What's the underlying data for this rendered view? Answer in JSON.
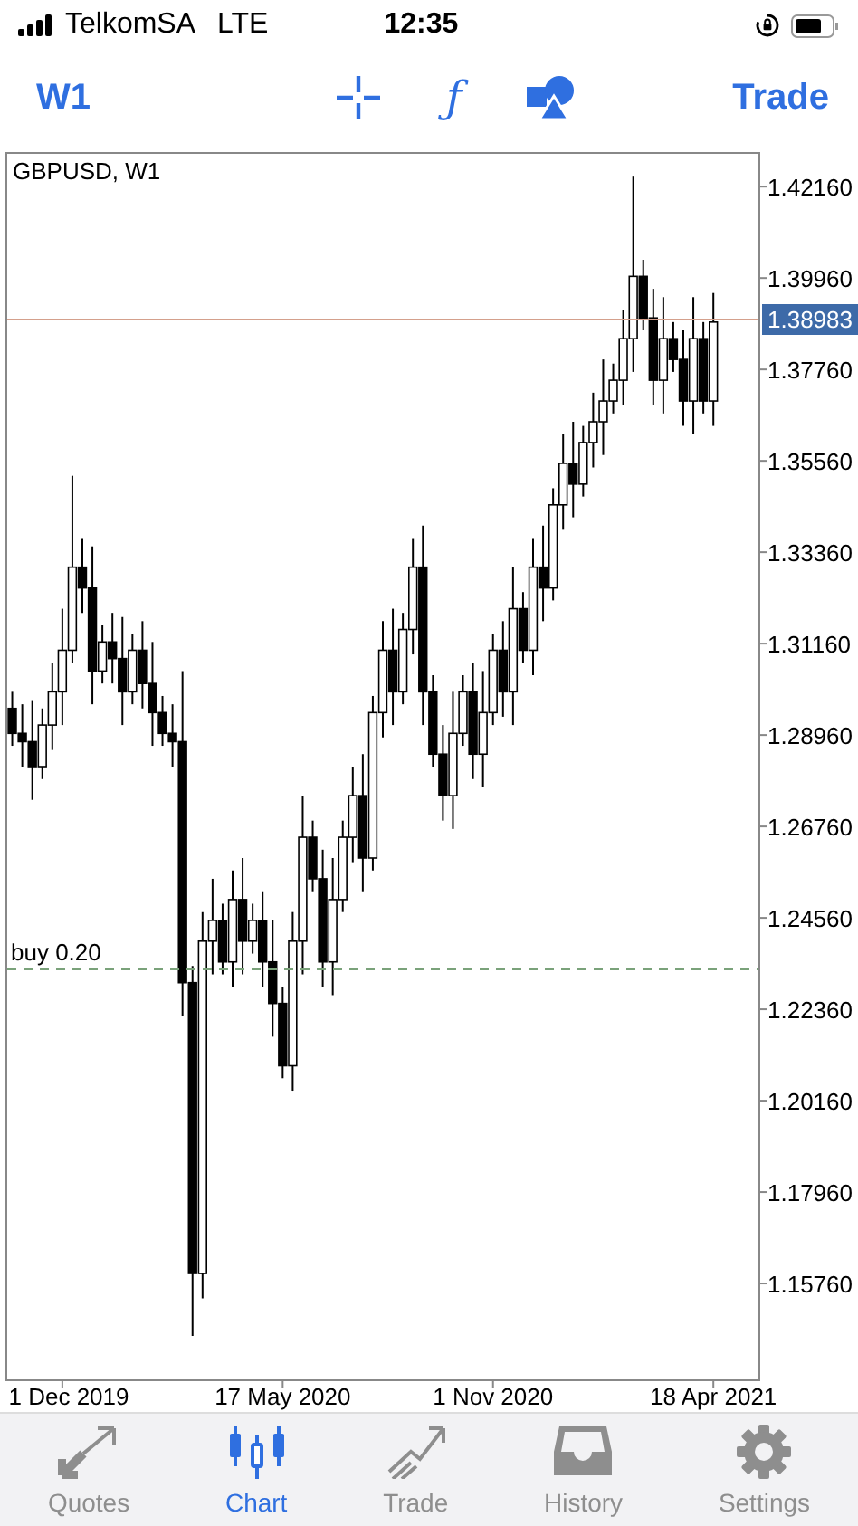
{
  "status_bar": {
    "carrier": "TelkomSA",
    "network": "LTE",
    "time": "12:35"
  },
  "toolbar": {
    "timeframe": "W1",
    "function_glyph": "ƒ",
    "trade": "Trade"
  },
  "chart": {
    "chart_data": {
      "type": "candlestick",
      "title": "GBPUSD, W1",
      "categories": [
        null,
        null,
        null,
        null,
        null,
        "1 Dec 2019",
        null,
        null,
        null,
        null,
        null,
        null,
        null,
        null,
        null,
        null,
        null,
        null,
        null,
        null,
        null,
        null,
        null,
        null,
        null,
        null,
        null,
        "17 May 2020",
        null,
        null,
        null,
        null,
        null,
        null,
        null,
        null,
        null,
        null,
        null,
        null,
        null,
        null,
        null,
        null,
        null,
        null,
        null,
        null,
        "1 Nov 2020",
        null,
        null,
        null,
        null,
        null,
        null,
        null,
        null,
        null,
        null,
        null,
        null,
        null,
        null,
        null,
        null,
        null,
        null,
        null,
        null,
        null,
        "18 Apr 2021",
        null,
        null,
        null,
        null
      ],
      "ohlc": [
        [
          1.296,
          1.3,
          1.287,
          1.29
        ],
        [
          1.29,
          1.297,
          1.282,
          1.288
        ],
        [
          1.288,
          1.298,
          1.274,
          1.282
        ],
        [
          1.282,
          1.296,
          1.279,
          1.292
        ],
        [
          1.292,
          1.307,
          1.286,
          1.3
        ],
        [
          1.3,
          1.32,
          1.292,
          1.31
        ],
        [
          1.31,
          1.352,
          1.307,
          1.33
        ],
        [
          1.33,
          1.337,
          1.319,
          1.325
        ],
        [
          1.325,
          1.335,
          1.297,
          1.305
        ],
        [
          1.305,
          1.316,
          1.302,
          1.312
        ],
        [
          1.312,
          1.319,
          1.302,
          1.308
        ],
        [
          1.308,
          1.318,
          1.292,
          1.3
        ],
        [
          1.3,
          1.314,
          1.297,
          1.31
        ],
        [
          1.31,
          1.317,
          1.296,
          1.302
        ],
        [
          1.302,
          1.312,
          1.287,
          1.295
        ],
        [
          1.295,
          1.299,
          1.287,
          1.29
        ],
        [
          1.29,
          1.297,
          1.282,
          1.288
        ],
        [
          1.288,
          1.305,
          1.222,
          1.23
        ],
        [
          1.23,
          1.234,
          1.145,
          1.16
        ],
        [
          1.16,
          1.247,
          1.154,
          1.24
        ],
        [
          1.24,
          1.255,
          1.232,
          1.245
        ],
        [
          1.245,
          1.249,
          1.232,
          1.235
        ],
        [
          1.235,
          1.257,
          1.229,
          1.25
        ],
        [
          1.25,
          1.26,
          1.232,
          1.24
        ],
        [
          1.24,
          1.249,
          1.237,
          1.245
        ],
        [
          1.245,
          1.252,
          1.229,
          1.235
        ],
        [
          1.235,
          1.245,
          1.217,
          1.225
        ],
        [
          1.225,
          1.229,
          1.207,
          1.21
        ],
        [
          1.21,
          1.247,
          1.204,
          1.24
        ],
        [
          1.24,
          1.275,
          1.232,
          1.265
        ],
        [
          1.265,
          1.269,
          1.252,
          1.255
        ],
        [
          1.255,
          1.262,
          1.229,
          1.235
        ],
        [
          1.235,
          1.26,
          1.227,
          1.25
        ],
        [
          1.25,
          1.269,
          1.247,
          1.265
        ],
        [
          1.265,
          1.282,
          1.259,
          1.275
        ],
        [
          1.275,
          1.285,
          1.252,
          1.26
        ],
        [
          1.26,
          1.299,
          1.257,
          1.295
        ],
        [
          1.295,
          1.317,
          1.289,
          1.31
        ],
        [
          1.31,
          1.32,
          1.292,
          1.3
        ],
        [
          1.3,
          1.319,
          1.297,
          1.315
        ],
        [
          1.315,
          1.337,
          1.309,
          1.33
        ],
        [
          1.33,
          1.34,
          1.292,
          1.3
        ],
        [
          1.3,
          1.304,
          1.282,
          1.285
        ],
        [
          1.285,
          1.292,
          1.269,
          1.275
        ],
        [
          1.275,
          1.3,
          1.267,
          1.29
        ],
        [
          1.29,
          1.304,
          1.287,
          1.3
        ],
        [
          1.3,
          1.307,
          1.279,
          1.285
        ],
        [
          1.285,
          1.305,
          1.277,
          1.295
        ],
        [
          1.295,
          1.314,
          1.292,
          1.31
        ],
        [
          1.31,
          1.317,
          1.294,
          1.3
        ],
        [
          1.3,
          1.33,
          1.292,
          1.32
        ],
        [
          1.32,
          1.324,
          1.307,
          1.31
        ],
        [
          1.31,
          1.337,
          1.304,
          1.33
        ],
        [
          1.33,
          1.34,
          1.317,
          1.325
        ],
        [
          1.325,
          1.349,
          1.322,
          1.345
        ],
        [
          1.345,
          1.362,
          1.339,
          1.355
        ],
        [
          1.355,
          1.365,
          1.342,
          1.35
        ],
        [
          1.35,
          1.364,
          1.347,
          1.36
        ],
        [
          1.36,
          1.372,
          1.354,
          1.365
        ],
        [
          1.365,
          1.38,
          1.357,
          1.37
        ],
        [
          1.37,
          1.379,
          1.367,
          1.375
        ],
        [
          1.375,
          1.392,
          1.369,
          1.385
        ],
        [
          1.385,
          1.424,
          1.377,
          1.4
        ],
        [
          1.4,
          1.404,
          1.387,
          1.39
        ],
        [
          1.39,
          1.397,
          1.369,
          1.375
        ],
        [
          1.375,
          1.395,
          1.367,
          1.385
        ],
        [
          1.385,
          1.389,
          1.377,
          1.38
        ],
        [
          1.38,
          1.387,
          1.364,
          1.37
        ],
        [
          1.37,
          1.395,
          1.362,
          1.385
        ],
        [
          1.385,
          1.389,
          1.367,
          1.37
        ],
        [
          1.37,
          1.396,
          1.364,
          1.389
        ],
        null,
        null,
        null,
        null
      ],
      "ylim": [
        1.1343,
        1.4297
      ],
      "yticks": [
        {
          "value": 1.4216,
          "label": "1.42160"
        },
        {
          "value": 1.3996,
          "label": "1.39960"
        },
        {
          "value": 1.3776,
          "label": "1.37760"
        },
        {
          "value": 1.3556,
          "label": "1.35560"
        },
        {
          "value": 1.3336,
          "label": "1.33360"
        },
        {
          "value": 1.3116,
          "label": "1.31160"
        },
        {
          "value": 1.2896,
          "label": "1.28960"
        },
        {
          "value": 1.2676,
          "label": "1.26760"
        },
        {
          "value": 1.2456,
          "label": "1.24560"
        },
        {
          "value": 1.2236,
          "label": "1.22360"
        },
        {
          "value": 1.2016,
          "label": "1.20160"
        },
        {
          "value": 1.1796,
          "label": "1.17960"
        },
        {
          "value": 1.1576,
          "label": "1.15760"
        }
      ],
      "ref_lines": [
        {
          "axis": "y",
          "value": 1.38983,
          "label": "1.38983"
        },
        {
          "axis": "y",
          "value": 1.2335,
          "label": "buy 0.20"
        }
      ]
    }
  },
  "tabs": [
    {
      "label": "Quotes",
      "selected": false
    },
    {
      "label": "Chart",
      "selected": true
    },
    {
      "label": "Trade",
      "selected": false
    },
    {
      "label": "History",
      "selected": false
    },
    {
      "label": "Settings",
      "selected": false
    }
  ]
}
